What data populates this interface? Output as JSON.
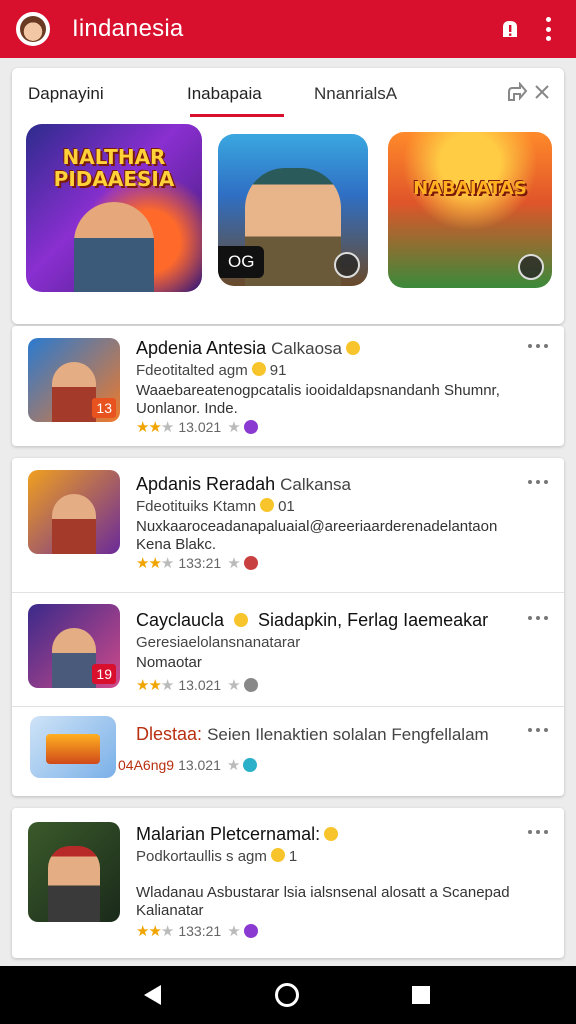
{
  "app_bar": {
    "title": "Iindanesia",
    "accent_color": "#d8102e",
    "icons": [
      "avatar",
      "alert-icon",
      "more-vert-icon"
    ]
  },
  "featured": {
    "tabs": [
      {
        "label": "Dapnayini"
      },
      {
        "label": "Inabapaia",
        "selected": true
      },
      {
        "label": "NnanrialsA"
      }
    ],
    "banners": [
      {
        "title": "NALTHAR PIDAAESIA"
      },
      {
        "badge": "OG"
      },
      {
        "title": "NABAIATAS"
      }
    ]
  },
  "list": [
    {
      "title": "Apdenia Antesia",
      "title_suffix": "Calkaosa",
      "subtitle": "Fdeotitalted agm",
      "subtitle_count": "91",
      "description": "Waaebareatenogpcatalis iooidaldapsnandanh Shumnr, Uonlanor. Inde.",
      "rating_text": "13.021",
      "badge_number": "13",
      "tag_color": "#8a3ad0"
    },
    {
      "title": "Apdanis Reradah",
      "title_suffix": "Calkansa",
      "subtitle": "Fdeotituiks Ktamn",
      "subtitle_count": "01",
      "description": "Nuxkaaroceadanapaluaial@areeriaarderenadelantaon Kena Blakc.",
      "rating_text": "133:21",
      "tag_color": "#c84040"
    },
    {
      "title": "Cayclaucla",
      "title_suffix": "Siadapkin, Ferlag Iaemeakar",
      "subtitle": "Geresiaelolansnanatarar",
      "description": "Nomaotar",
      "rating_text": "13.021",
      "badge_number": "19",
      "tag_color": "#888888"
    },
    {
      "title": "Dlestaa:",
      "title_suffix": "Seien Ilenaktien solalan Fengfellalam",
      "rating_prefix": "04A6ng9",
      "rating_text": "13.021",
      "tag_color": "#2ab0c8"
    },
    {
      "title": "Malarian Pletcernamal:",
      "subtitle": "Podkortaullis s agm",
      "subtitle_count": "1",
      "description": "Wladanau Asbustarar lsia ialsnsenal alosatt a Scanepad Kalianatar",
      "rating_text": "133:21",
      "tag_color": "#8a3ad0"
    }
  ],
  "nav_bar": {
    "buttons": [
      "back",
      "home",
      "recents"
    ]
  }
}
